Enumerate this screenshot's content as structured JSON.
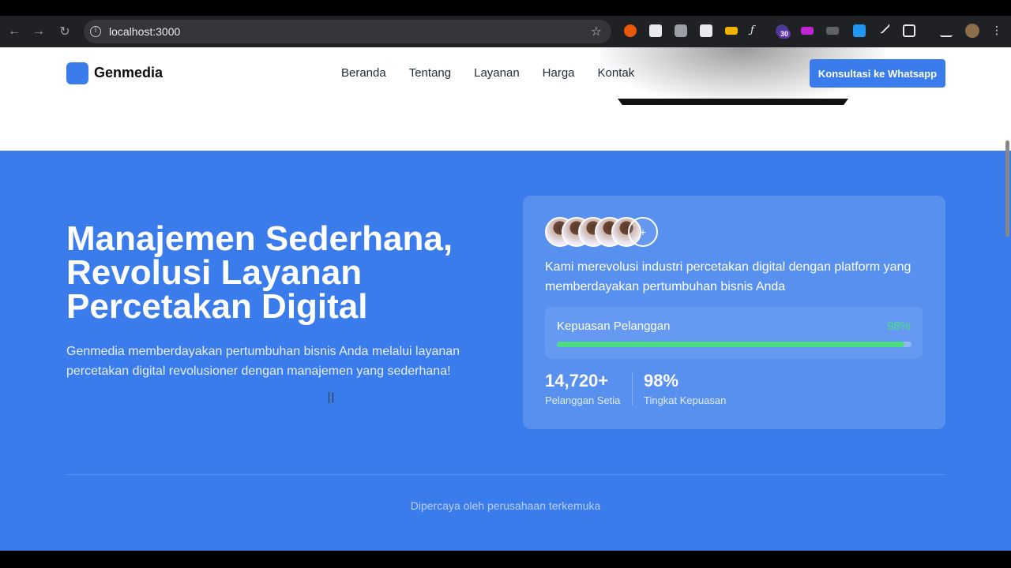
{
  "browser": {
    "url": "localhost:3000",
    "back_icon": "←",
    "forward_icon": "→",
    "reload_icon": "↻",
    "info_icon": "i",
    "star_icon": "☆",
    "extension_badge": "30"
  },
  "header": {
    "brand": "Genmedia",
    "brand_color": "#3b7ced",
    "nav": [
      "Beranda",
      "Tentang",
      "Layanan",
      "Harga",
      "Kontak"
    ],
    "cta_label": "Konsultasi ke Whatsapp"
  },
  "hero": {
    "title": "Manajemen Sederhana, Revolusi Layanan Percetakan Digital",
    "description": "Genmedia memberdayakan pertumbuhan bisnis Anda melalui layanan percetakan digital revolusioner dengan manajemen yang sederhana!",
    "background": "#3b7ced"
  },
  "card": {
    "avatar_plus": "+",
    "intro": "Kami merevolusi industri percetakan digital dengan platform yang memberdayakan pertumbuhan bisnis Anda",
    "satisfaction": {
      "label": "Kepuasan Pelanggan",
      "value_text": "98%",
      "value": 0.98,
      "color": "#4ade80"
    },
    "stats": [
      {
        "number": "14,720+",
        "label": "Pelanggan Setia"
      },
      {
        "number": "98%",
        "label": "Tingkat Kepuasan"
      }
    ]
  },
  "trusted": {
    "label": "Dipercaya oleh perusahaan terkemuka"
  }
}
